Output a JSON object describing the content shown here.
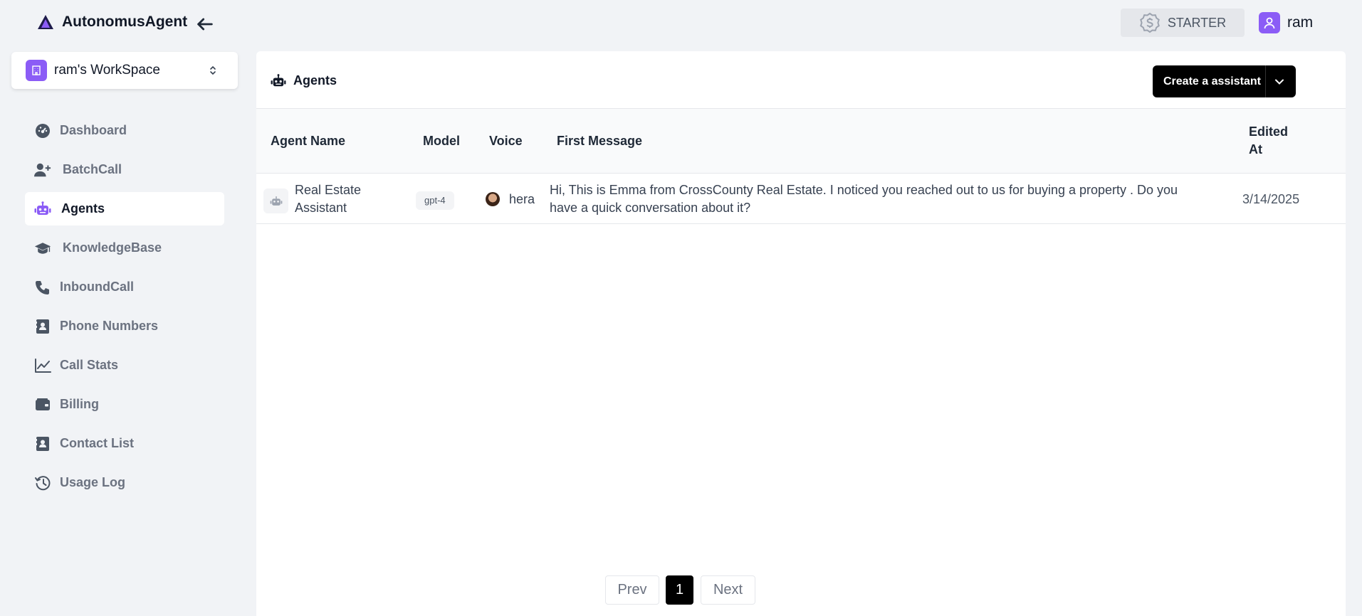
{
  "header": {
    "brand_name": "AutonomusAgent",
    "plan_label": "STARTER",
    "user_name": "ram"
  },
  "sidebar": {
    "workspace_name": "ram's WorkSpace",
    "items": [
      {
        "label": "Dashboard",
        "icon": "dashboard-icon"
      },
      {
        "label": "BatchCall",
        "icon": "user-plus-icon"
      },
      {
        "label": "Agents",
        "icon": "robot-icon",
        "active": true
      },
      {
        "label": "KnowledgeBase",
        "icon": "graduation-cap-icon"
      },
      {
        "label": "InboundCall",
        "icon": "phone-icon"
      },
      {
        "label": "Phone Numbers",
        "icon": "contact-book-icon"
      },
      {
        "label": "Call Stats",
        "icon": "line-chart-icon"
      },
      {
        "label": "Billing",
        "icon": "wallet-icon"
      },
      {
        "label": "Contact List",
        "icon": "contact-book-icon"
      },
      {
        "label": "Usage Log",
        "icon": "history-icon"
      }
    ]
  },
  "main": {
    "title": "Agents",
    "create_button_label": "Create a assistant",
    "columns": {
      "agent_name": "Agent Name",
      "model": "Model",
      "voice": "Voice",
      "first_message": "First Message",
      "edited_at_line1": "Edited",
      "edited_at_line2": "At"
    },
    "rows": [
      {
        "agent_name_line1": "Real Estate",
        "agent_name_line2": "Assistant",
        "model": "gpt-4",
        "voice": "hera",
        "first_message_line1": "Hi, This is Emma from CrossCounty Real Estate. I noticed you reached out to us for buying a property . Do you",
        "first_message_line2": "have a quick conversation about it?",
        "edited_at": "3/14/2025"
      }
    ],
    "pagination": {
      "prev_label": "Prev",
      "current_page": "1",
      "next_label": "Next"
    }
  },
  "colors": {
    "accent": "#8b5cf6",
    "background": "#f1f3f6",
    "primary_button": "#000000"
  }
}
